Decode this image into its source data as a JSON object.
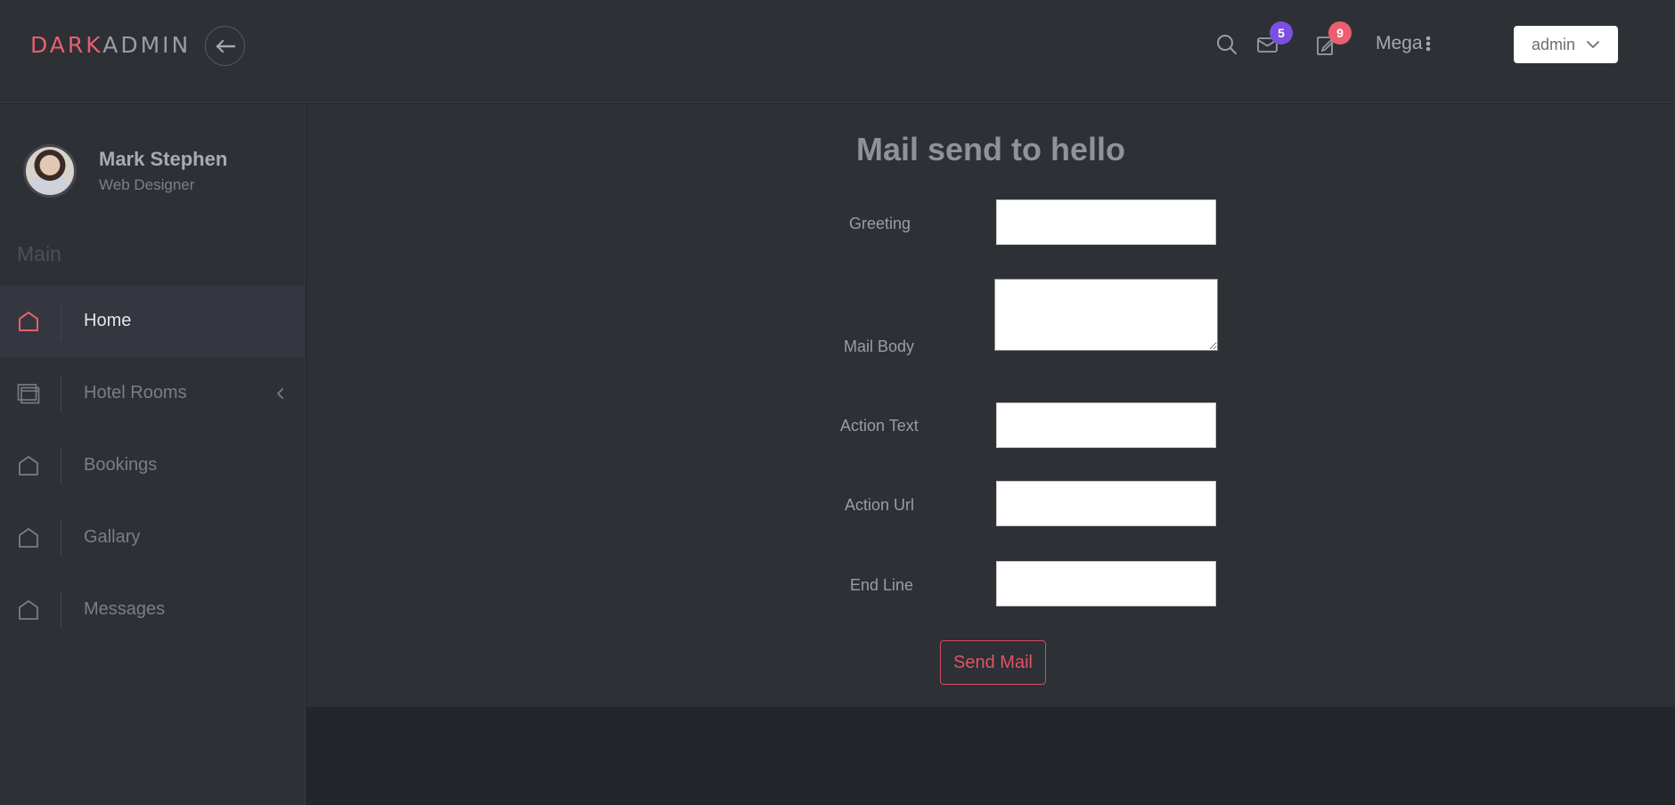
{
  "brand": {
    "part1": "DARK",
    "part2": "ADMIN"
  },
  "header": {
    "mail_badge": "5",
    "tasks_badge": "9",
    "mega_label": "Mega",
    "user_dropdown": "admin",
    "colors": {
      "accent": "#e95f6f",
      "mail_badge": "#7b4fe0",
      "tasks_badge": "#e95f6f"
    }
  },
  "profile": {
    "name": "Mark Stephen",
    "role": "Web Designer"
  },
  "sidebar": {
    "section": "Main",
    "items": [
      {
        "label": "Home",
        "icon": "home-icon",
        "active": true
      },
      {
        "label": "Hotel Rooms",
        "icon": "window-stack-icon",
        "has_submenu": true
      },
      {
        "label": "Bookings",
        "icon": "home-icon"
      },
      {
        "label": "Gallary",
        "icon": "home-icon"
      },
      {
        "label": "Messages",
        "icon": "home-icon"
      }
    ]
  },
  "main": {
    "title": "Mail send to hello",
    "form": {
      "greeting_label": "Greeting",
      "greeting_value": "",
      "body_label": "Mail Body",
      "body_value": "",
      "action_text_label": "Action Text",
      "action_text_value": "",
      "action_url_label": "Action Url",
      "action_url_value": "",
      "end_line_label": "End Line",
      "end_line_value": "",
      "submit_label": "Send Mail"
    }
  }
}
